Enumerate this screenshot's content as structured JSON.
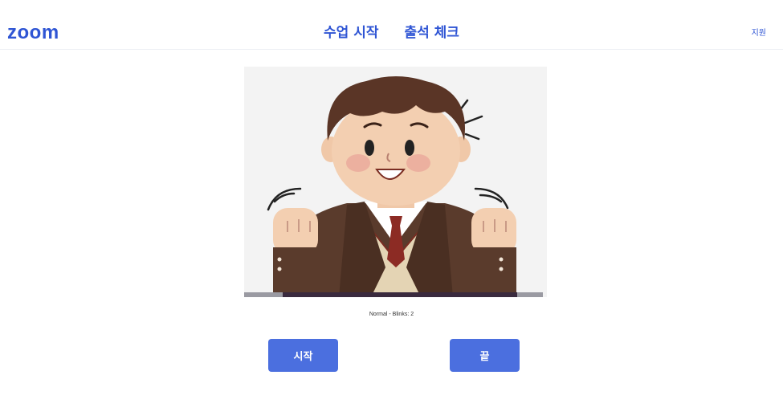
{
  "header": {
    "logo": "zoom",
    "nav": [
      "수업 시작",
      "출석 체크"
    ],
    "support": "지원"
  },
  "video": {
    "status": "Normal - Blinks: 2"
  },
  "buttons": {
    "start": "시작",
    "end": "끝"
  },
  "colors": {
    "brand": "#2f55d4",
    "button": "#4b6fdf"
  }
}
